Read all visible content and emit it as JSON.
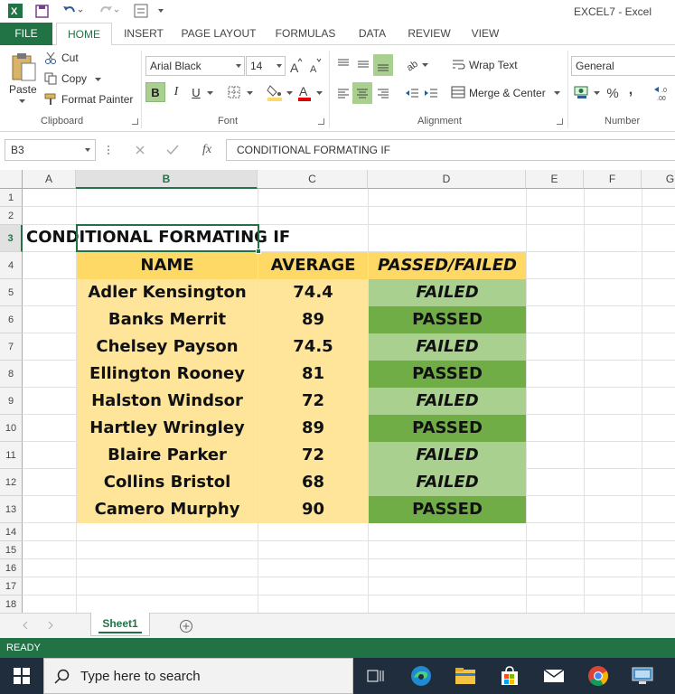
{
  "window": {
    "title": "EXCEL7 - Excel"
  },
  "ribbon_tabs": [
    {
      "label": "FILE"
    },
    {
      "label": "HOME"
    },
    {
      "label": "INSERT"
    },
    {
      "label": "PAGE LAYOUT"
    },
    {
      "label": "FORMULAS"
    },
    {
      "label": "DATA"
    },
    {
      "label": "REVIEW"
    },
    {
      "label": "VIEW"
    }
  ],
  "ribbon": {
    "clipboard": {
      "paste": "Paste",
      "cut": "Cut",
      "copy": "Copy",
      "format_painter": "Format Painter",
      "label": "Clipboard"
    },
    "font": {
      "name": "Arial Black",
      "size": "14",
      "bold": "B",
      "italic": "I",
      "underline": "U",
      "label": "Font"
    },
    "alignment": {
      "wrap_text": "Wrap Text",
      "merge_center": "Merge & Center",
      "label": "Alignment"
    },
    "number": {
      "format": "General",
      "percent": "%",
      "comma": ",",
      "label": "Number"
    }
  },
  "formula_bar": {
    "name_box": "B3",
    "fx": "fx",
    "content": "CONDITIONAL FORMATING IF"
  },
  "columns": [
    "A",
    "B",
    "C",
    "D",
    "E",
    "F",
    "G"
  ],
  "rows": [
    "1",
    "2",
    "3",
    "4",
    "5",
    "6",
    "7",
    "8",
    "9",
    "10",
    "11",
    "12",
    "13",
    "14",
    "15",
    "16",
    "17",
    "18"
  ],
  "sheet": {
    "title": "CONDITIONAL FORMATING IF",
    "headers": {
      "name": "NAME",
      "average": "AVERAGE",
      "result": "PASSED/FAILED"
    },
    "records": [
      {
        "name": "Adler Kensington",
        "average": "74.4",
        "result": "FAILED"
      },
      {
        "name": "Banks Merrit",
        "average": "89",
        "result": "PASSED"
      },
      {
        "name": "Chelsey Payson",
        "average": "74.5",
        "result": "FAILED"
      },
      {
        "name": "Ellington Rooney",
        "average": "81",
        "result": "PASSED"
      },
      {
        "name": "Halston Windsor",
        "average": "72",
        "result": "FAILED"
      },
      {
        "name": "Hartley Wringley",
        "average": "89",
        "result": "PASSED"
      },
      {
        "name": "Blaire Parker",
        "average": "72",
        "result": "FAILED"
      },
      {
        "name": "Collins Bristol",
        "average": "68",
        "result": "FAILED"
      },
      {
        "name": "Camero Murphy",
        "average": "90",
        "result": "PASSED"
      }
    ]
  },
  "sheet_tabs": [
    {
      "label": "Sheet1"
    }
  ],
  "status": "READY",
  "taskbar": {
    "search_placeholder": "Type here to search"
  },
  "colors": {
    "excel_green": "#217346",
    "fill_yellow": "#fee599",
    "fill_header": "#ffd966",
    "failed": "#a9d08e",
    "passed": "#70ad47"
  }
}
